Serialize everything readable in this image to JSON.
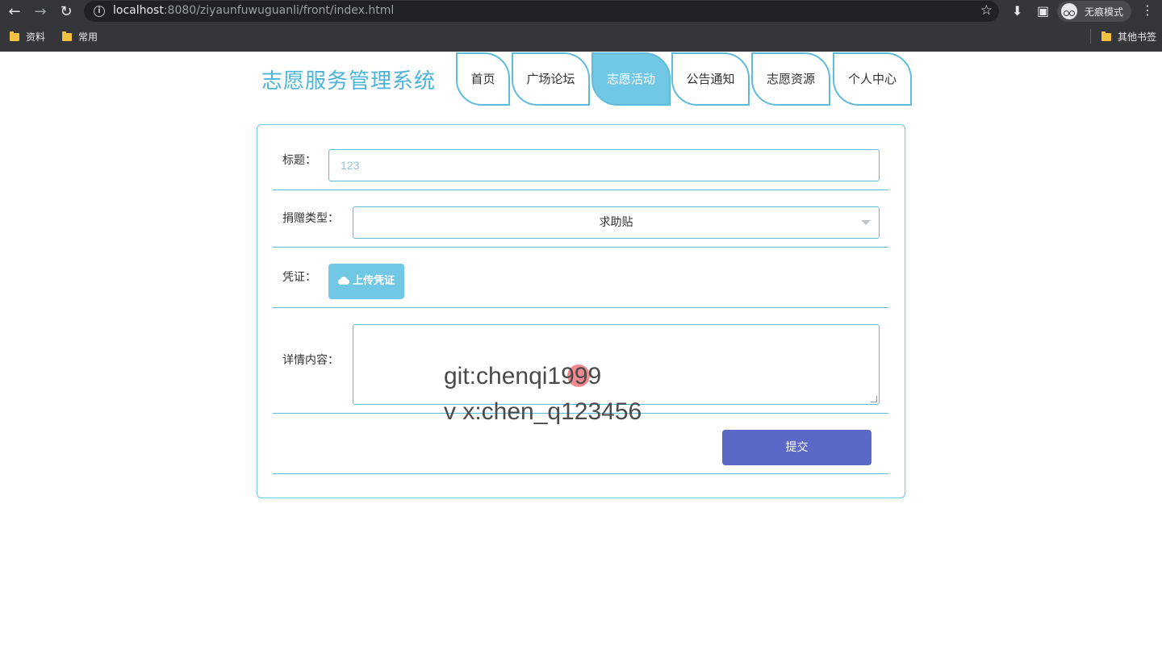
{
  "browser": {
    "url_host": "localhost",
    "url_rest": ":8080/ziyaunfuwuguanli/front/index.html",
    "incognito_label": "无痕模式",
    "bookmarks": [
      "资料",
      "常用"
    ],
    "other_bookmarks": "其他书签"
  },
  "site": {
    "title": "志愿服务管理系统",
    "nav": [
      "首页",
      "广场论坛",
      "志愿活动",
      "公告通知",
      "志愿资源",
      "个人中心"
    ],
    "active_tab": "志愿活动"
  },
  "form": {
    "title_label": "标题：",
    "title_value": "123",
    "type_label": "捐赠类型：",
    "type_value": "求助贴",
    "proof_label": "凭证：",
    "upload_label": "上传凭证",
    "detail_label": "详情内容：",
    "submit_label": "提交"
  },
  "overlay": {
    "line1": "git:chenqi1999",
    "line2": "v x:chen_q123456"
  },
  "colors": {
    "accent": "#5fbcd9",
    "active_tab": "#71c8e4",
    "submit": "#5b68c5"
  }
}
